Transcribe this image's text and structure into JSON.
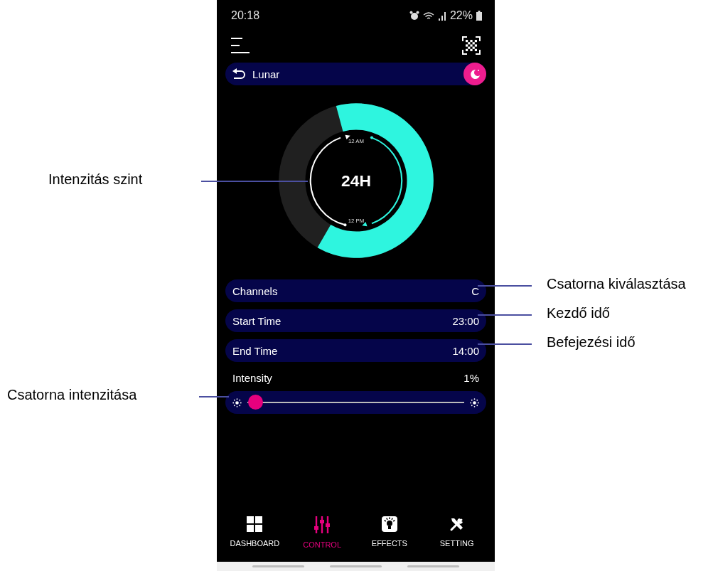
{
  "status_bar": {
    "time": "20:18",
    "battery": "22%"
  },
  "mode_bar": {
    "title": "Lunar"
  },
  "dial": {
    "center_label": "24H",
    "top_label": "12 AM",
    "bottom_label": "12 PM"
  },
  "settings": [
    {
      "label": "Channels",
      "value": "C"
    },
    {
      "label": "Start Time",
      "value": "23:00"
    },
    {
      "label": "End Time",
      "value": "14:00"
    }
  ],
  "intensity": {
    "label": "Intensity",
    "reading": "1%",
    "level": 0.01
  },
  "nav": [
    {
      "label": "DASHBOARD",
      "selected": false
    },
    {
      "label": "CONTROL",
      "selected": true
    },
    {
      "label": "EFFECTS",
      "selected": false
    },
    {
      "label": "SETTING",
      "selected": false
    }
  ],
  "callouts": [
    {
      "text": "Intenzitás szint"
    },
    {
      "text": "Csatorna kiválasztása"
    },
    {
      "text": "Kezdő idő"
    },
    {
      "text": "Befejezési idő"
    },
    {
      "text": "Csatorna intenzitása"
    }
  ]
}
